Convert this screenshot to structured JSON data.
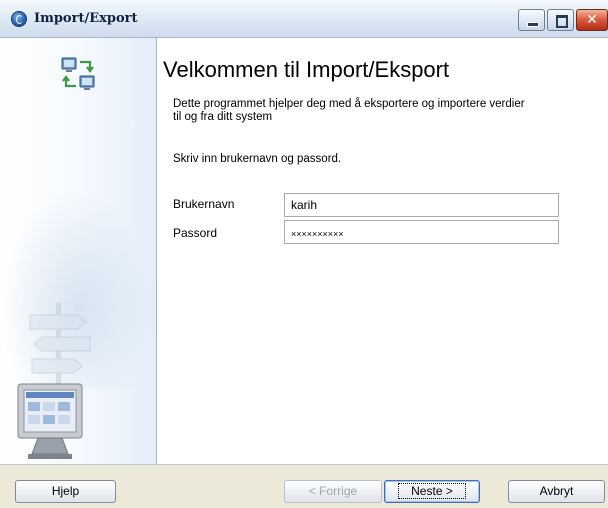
{
  "window": {
    "title": "Import/Export"
  },
  "content": {
    "heading": "Velkommen til Import/Eksport",
    "intro_line1": "Dette programmet hjelper deg med å eksportere og importere verdier",
    "intro_line2": "til og fra ditt system",
    "prompt": "Skriv inn brukernavn og passord.",
    "username_label": "Brukernavn",
    "username_value": "karih",
    "password_label": "Passord",
    "password_value": "××××××××××"
  },
  "footer": {
    "help_label": "Hjelp",
    "back_label": "< Forrige",
    "next_label": "Neste >",
    "cancel_label": "Avbryt"
  },
  "colors": {
    "close_button": "#d9583a",
    "sidebar_border": "#a3b4c9",
    "footer_background": "#ece9d8"
  },
  "icons": {
    "app": "app-logo-icon",
    "sidebar_top": "transfer-computers-icon",
    "sidebar_middle": "signpost-icon",
    "sidebar_bottom": "monitor-icon"
  }
}
